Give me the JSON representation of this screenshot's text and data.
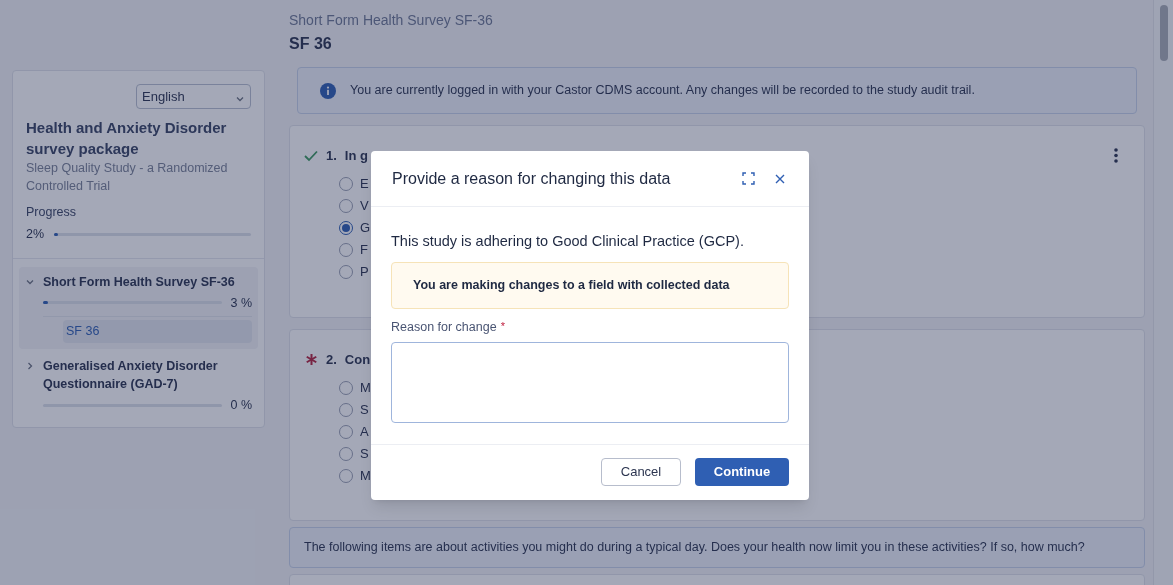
{
  "header": {
    "subtitle": "Short Form Health Survey SF-36",
    "title": "SF 36"
  },
  "sidebar": {
    "language": "English",
    "package_title": "Health and Anxiety Disorder survey package",
    "study": "Sleep Quality Study - a Randomized Controlled Trial",
    "progress_label": "Progress",
    "progress_value": "2%",
    "level": 0.02,
    "sections": [
      {
        "title": "Short Form Health Survey SF-36",
        "expanded": true,
        "level": 0.03,
        "percent": "3 %",
        "children": [
          {
            "label": "SF 36",
            "selected": true
          }
        ]
      },
      {
        "title": "Generalised Anxiety Disorder Questionnaire (GAD-7)",
        "expanded": false,
        "level": 0,
        "percent": "0 %"
      }
    ]
  },
  "notice": "You are currently logged in with your Castor CDMS account. Any changes will be recorded to the study audit trail.",
  "questions": [
    {
      "kind": "answered",
      "number": "1.",
      "text": "In g",
      "options": [
        {
          "label": "E",
          "selected": false
        },
        {
          "label": "V",
          "selected": false
        },
        {
          "label": "G",
          "selected": true
        },
        {
          "label": "F",
          "selected": false
        },
        {
          "label": "P",
          "selected": false
        }
      ]
    },
    {
      "kind": "required",
      "number": "2.",
      "text": "Con",
      "options": [
        {
          "label": "M",
          "selected": false
        },
        {
          "label": "S",
          "selected": false
        },
        {
          "label": "A",
          "selected": false
        },
        {
          "label": "S",
          "selected": false
        },
        {
          "label": "M",
          "selected": false
        }
      ]
    }
  ],
  "instruction": "The following items are about activities you might do during a typical day. Does your health now limit you in these activities? If so, how much?",
  "dialog": {
    "title": "Provide a reason for changing this data",
    "message": "This study is adhering to Good Clinical Practice (GCP).",
    "warning": "You are making changes to a field with collected data",
    "field_label": "Reason for change",
    "required_mark": "*",
    "buttons": [
      {
        "label": "Cancel",
        "kind": "secondary"
      },
      {
        "label": "Continue",
        "kind": "primary"
      }
    ]
  }
}
